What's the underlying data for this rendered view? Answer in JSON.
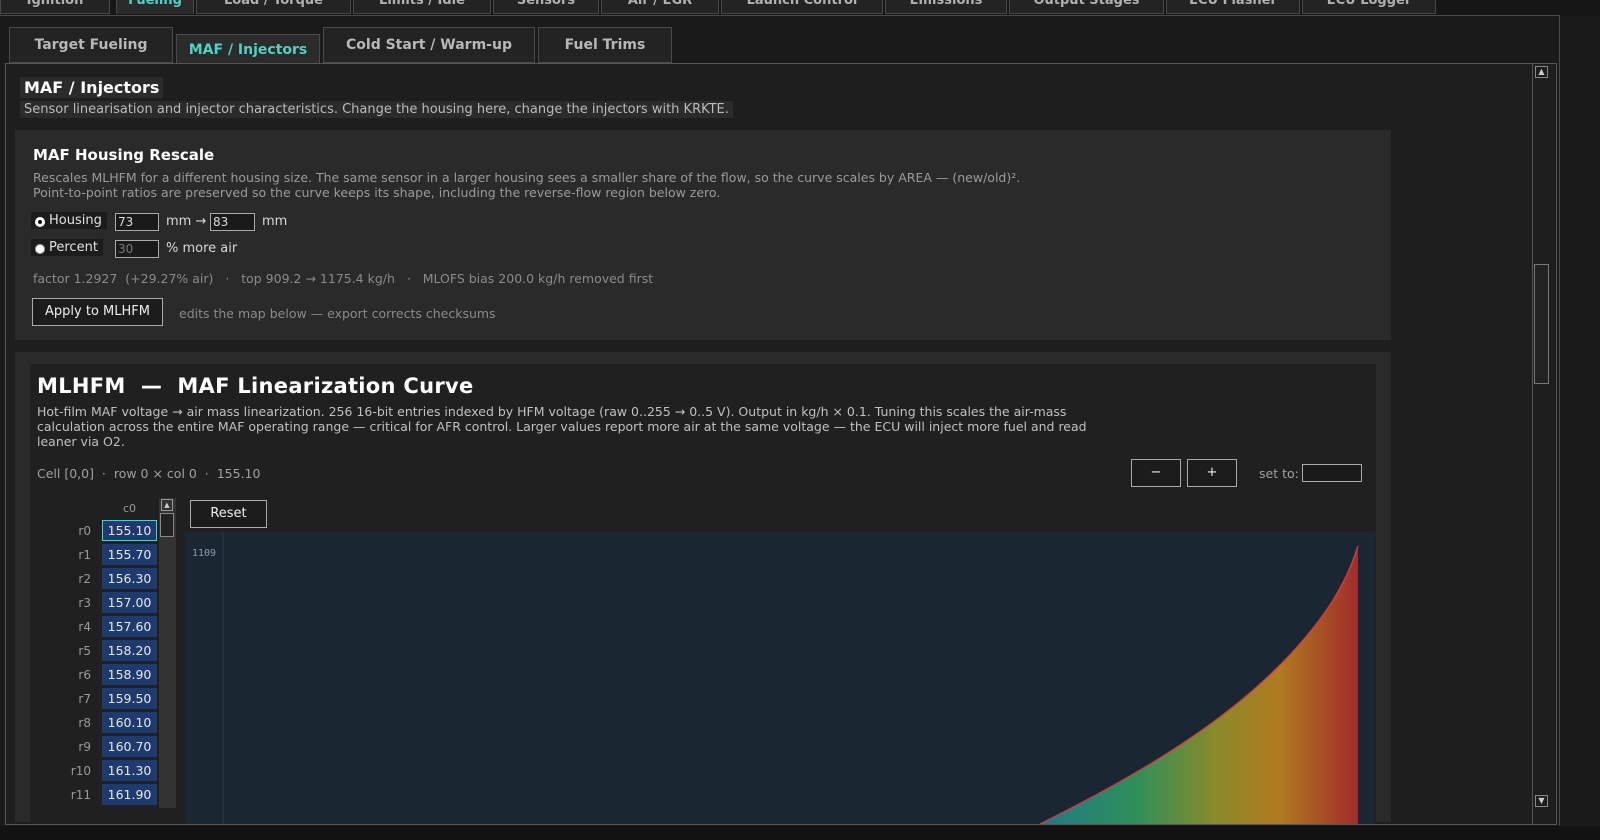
{
  "top_tabs": [
    {
      "label": "Ignition"
    },
    {
      "label": "Fueling"
    },
    {
      "label": "Load / Torque"
    },
    {
      "label": "Limits / Idle"
    },
    {
      "label": "Sensors"
    },
    {
      "label": "Air / EGR"
    },
    {
      "label": "Launch Control"
    },
    {
      "label": "Emissions"
    },
    {
      "label": "Output Stages"
    },
    {
      "label": "ECU Flasher"
    },
    {
      "label": "ECU Logger"
    }
  ],
  "sub_tabs": [
    {
      "label": "Target Fueling"
    },
    {
      "label": "MAF / Injectors"
    },
    {
      "label": "Cold Start / Warm-up"
    },
    {
      "label": "Fuel Trims"
    }
  ],
  "page": {
    "title": "MAF / Injectors",
    "subtitle": "Sensor linearisation and injector characteristics. Change the housing here, change the injectors with KRKTE."
  },
  "rescale": {
    "title": "MAF Housing Rescale",
    "desc1": "Rescales MLHFM for a different housing size. The same sensor in a larger housing sees a smaller share of the flow, so the curve scales by AREA — (new/old)².",
    "desc2": "Point-to-point ratios are preserved so the curve keeps its shape, including the reverse-flow region below zero.",
    "housing_label": "Housing",
    "housing_old": "73",
    "mm_arrow": "mm →",
    "housing_new": "83",
    "mm": "mm",
    "percent_label": "Percent",
    "percent_value": "30",
    "percent_suffix": "% more air",
    "factor_line": "factor 1.2927  (+29.27% air)   ·   top 909.2 → 1175.4 kg/h   ·   MLOFS bias 200.0 kg/h removed first",
    "apply_label": "Apply to MLHFM",
    "apply_note": "edits the map below — export corrects checksums"
  },
  "map": {
    "title": "MLHFM  —  MAF Linearization Curve",
    "desc1": "Hot-film MAF voltage → air mass linearization. 256 16-bit entries indexed by HFM voltage (raw 0..255 → 0..5 V). Output in kg/h × 0.1. Tuning this scales the air-mass",
    "desc2": "calculation across the entire MAF operating range — critical for AFR control. Larger values report more air at the same voltage — the ECU will inject more fuel and read",
    "desc3": "leaner via O2.",
    "cell_info": "Cell [0,0]  ·  row 0 × col 0  ·  155.10",
    "minus_label": "−",
    "plus_label": "+",
    "set_to_label": "set to:",
    "set_to_value": "",
    "col_header": "c0",
    "reset_label": "Reset",
    "plot_ymax_label": "1109",
    "rows": [
      {
        "label": "r0",
        "value": "155.10"
      },
      {
        "label": "r1",
        "value": "155.70"
      },
      {
        "label": "r2",
        "value": "156.30"
      },
      {
        "label": "r3",
        "value": "157.00"
      },
      {
        "label": "r4",
        "value": "157.60"
      },
      {
        "label": "r5",
        "value": "158.20"
      },
      {
        "label": "r6",
        "value": "158.90"
      },
      {
        "label": "r7",
        "value": "159.50"
      },
      {
        "label": "r8",
        "value": "160.10"
      },
      {
        "label": "r9",
        "value": "160.70"
      },
      {
        "label": "r10",
        "value": "161.30"
      },
      {
        "label": "r11",
        "value": "161.90"
      }
    ]
  },
  "colors": {
    "accent": "#4fd1c5",
    "cell_bg": "#1f3a6e",
    "plot_bg": "#1b2633"
  }
}
